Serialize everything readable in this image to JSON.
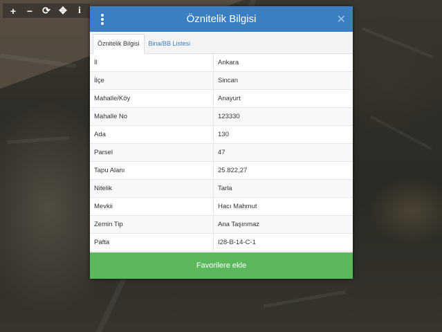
{
  "toolbar": {
    "zoom_in": "+",
    "zoom_out": "−",
    "refresh": "⟳",
    "locate": "✥",
    "info": "i"
  },
  "panel": {
    "title": "Öznitelik Bilgisi",
    "close": "✕",
    "tabs": [
      "Öznitelik Bilgisi",
      "Bina/BB Listesi"
    ],
    "rows": [
      {
        "key": "İl",
        "value": "Ankara"
      },
      {
        "key": "İlçe",
        "value": "Sincan"
      },
      {
        "key": "Mahalle/Köy",
        "value": "Anayurt"
      },
      {
        "key": "Mahalle No",
        "value": "123330"
      },
      {
        "key": "Ada",
        "value": "130"
      },
      {
        "key": "Parsel",
        "value": "47"
      },
      {
        "key": "Tapu Alanı",
        "value": "25.822,27"
      },
      {
        "key": "Nitelik",
        "value": "Tarla"
      },
      {
        "key": "Mevkii",
        "value": "Hacı Mahmut"
      },
      {
        "key": "Zemin Tip",
        "value": "Ana Taşınmaz"
      },
      {
        "key": "Pafta",
        "value": "I28-B-14-C-1"
      }
    ],
    "favorite_button": "Favorilere ekle"
  },
  "icons": [
    "zoom-in-icon",
    "zoom-out-icon",
    "refresh-icon",
    "locate-icon",
    "info-icon",
    "menu-icon",
    "close-icon"
  ],
  "colors": {
    "header": "#3a7fc2",
    "favorite": "#5cb85c"
  }
}
